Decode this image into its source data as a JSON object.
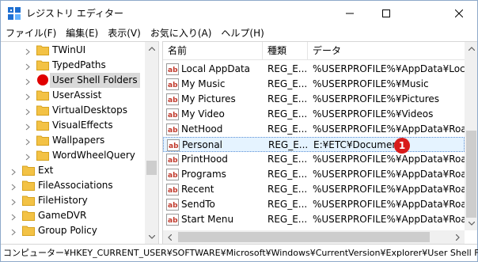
{
  "window": {
    "title": "レジストリ エディター"
  },
  "menu": {
    "items": [
      "ファイル(F)",
      "編集(E)",
      "表示(V)",
      "お気に入り(A)",
      "ヘルプ(H)"
    ]
  },
  "tree": {
    "items": [
      {
        "label": "TWinUI",
        "depth": 1,
        "selected": false
      },
      {
        "label": "TypedPaths",
        "depth": 1,
        "selected": false
      },
      {
        "label": "User Shell Folders",
        "depth": 1,
        "selected": true
      },
      {
        "label": "UserAssist",
        "depth": 1,
        "selected": false
      },
      {
        "label": "VirtualDesktops",
        "depth": 1,
        "selected": false
      },
      {
        "label": "VisualEffects",
        "depth": 1,
        "selected": false
      },
      {
        "label": "Wallpapers",
        "depth": 1,
        "selected": false
      },
      {
        "label": "WordWheelQuery",
        "depth": 1,
        "selected": false
      },
      {
        "label": "Ext",
        "depth": 0,
        "selected": false
      },
      {
        "label": "FileAssociations",
        "depth": 0,
        "selected": false
      },
      {
        "label": "FileHistory",
        "depth": 0,
        "selected": false
      },
      {
        "label": "GameDVR",
        "depth": 0,
        "selected": false
      },
      {
        "label": "Group Policy",
        "depth": 0,
        "selected": false
      }
    ]
  },
  "list": {
    "columns": [
      "名前",
      "種類",
      "データ"
    ],
    "rows": [
      {
        "name": "Local AppData",
        "type": "REG_E...",
        "data": "%USERPROFILE%¥AppData¥Local"
      },
      {
        "name": "My Music",
        "type": "REG_E...",
        "data": "%USERPROFILE%¥Music"
      },
      {
        "name": "My Pictures",
        "type": "REG_E...",
        "data": "%USERPROFILE%¥Pictures"
      },
      {
        "name": "My Video",
        "type": "REG_E...",
        "data": "%USERPROFILE%¥Videos"
      },
      {
        "name": "NetHood",
        "type": "REG_E...",
        "data": "%USERPROFILE%¥AppData¥Roamin"
      },
      {
        "name": "Personal",
        "type": "REG_E...",
        "data": "E:¥ETC¥Documents"
      },
      {
        "name": "PrintHood",
        "type": "REG_E...",
        "data": "%USERPROFILE%¥AppData¥Roamin"
      },
      {
        "name": "Programs",
        "type": "REG_E...",
        "data": "%USERPROFILE%¥AppData¥Roamin"
      },
      {
        "name": "Recent",
        "type": "REG_E...",
        "data": "%USERPROFILE%¥AppData¥Roamin"
      },
      {
        "name": "SendTo",
        "type": "REG_E...",
        "data": "%USERPROFILE%¥AppData¥Roamin"
      },
      {
        "name": "Start Menu",
        "type": "REG_E...",
        "data": "%USERPROFILE%¥AppData¥Roamin"
      }
    ],
    "focused_row": "Personal",
    "annotation": "1"
  },
  "status": {
    "path": "コンピューター¥HKEY_CURRENT_USER¥SOFTWARE¥Microsoft¥Windows¥CurrentVersion¥Explorer¥User Shell Folder"
  },
  "icons": {
    "app": "registry-editor-icon",
    "folder": "folder-icon",
    "value": "reg-string-value-icon",
    "folder_color": "#f3c245",
    "value_color": "#c0392b",
    "marker_color": "#e00000"
  }
}
